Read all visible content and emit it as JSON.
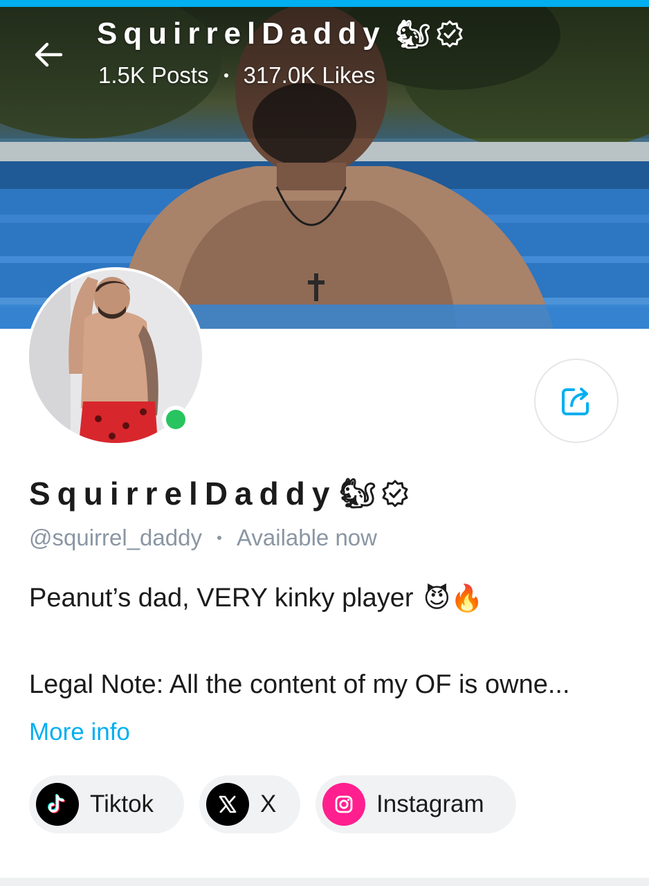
{
  "colors": {
    "accent": "#00aff0",
    "online": "#28c45f",
    "secondary_text": "#8a96a3",
    "instagram": "#ff1f8e"
  },
  "header": {
    "back_icon": "arrow-left-icon",
    "title": "SquirrelDaddy",
    "title_emoji": "🐿",
    "verified_icon": "verified-badge-icon",
    "posts": "1.5K Posts",
    "likes": "317.0K Likes"
  },
  "profile": {
    "display_name": "SquirrelDaddy",
    "name_emoji": "🐿",
    "verified_icon": "verified-badge-icon",
    "handle": "@squirrel_daddy",
    "status": "Available now",
    "share_icon": "share-icon",
    "bio_line1": "Peanut’s dad, VERY kinky player",
    "bio_emojis": "😈🔥",
    "bio_line2": "Legal Note: All the content of my OF is owne...",
    "more_info": "More info"
  },
  "social_links": [
    {
      "label": "Tiktok",
      "icon": "tiktok-icon"
    },
    {
      "label": "X",
      "icon": "x-icon"
    },
    {
      "label": "Instagram",
      "icon": "instagram-icon"
    }
  ]
}
